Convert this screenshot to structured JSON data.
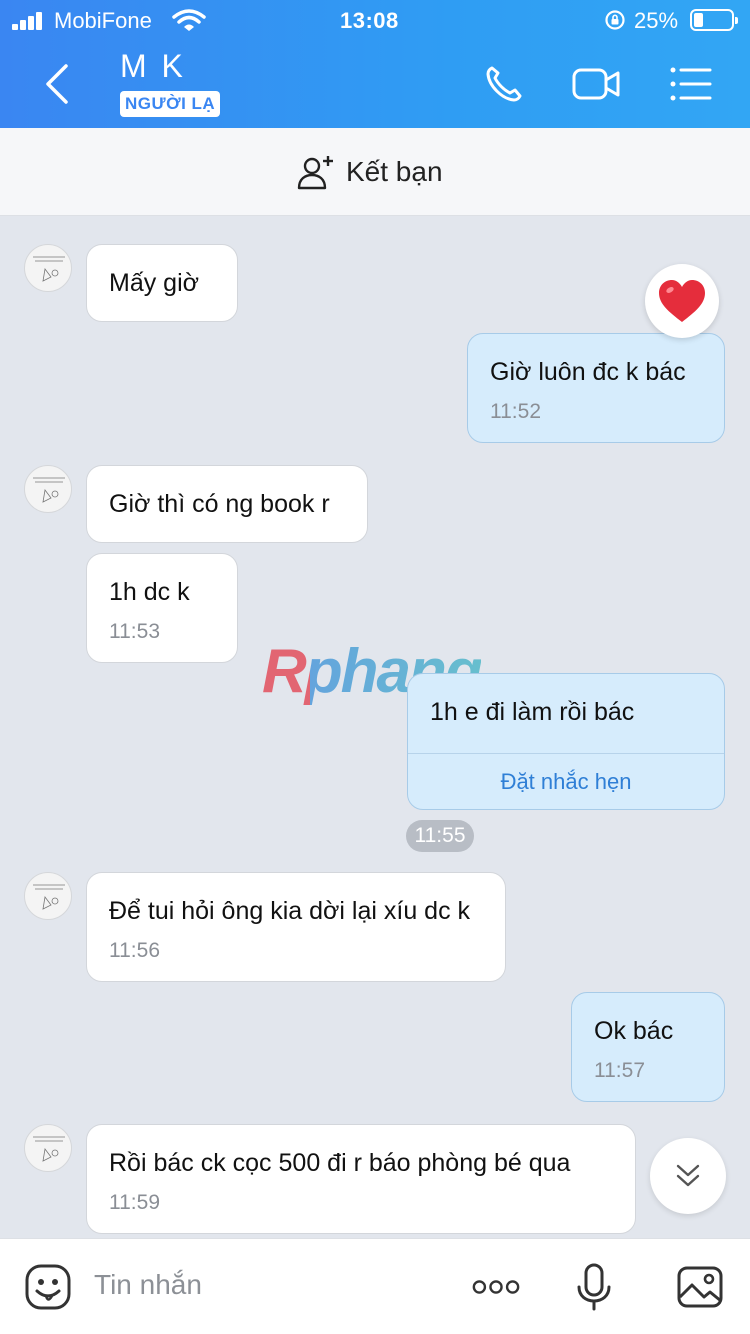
{
  "status_bar": {
    "carrier": "MobiFone",
    "time": "13:08",
    "battery": "25%"
  },
  "header": {
    "contact_name": "M K",
    "badge": "NGƯỜI LẠ"
  },
  "add_friend": {
    "label": "Kết bạn"
  },
  "messages": [
    {
      "side": "in",
      "text": "Mấy giờ",
      "time": ""
    },
    {
      "side": "out",
      "text": "Giờ luôn đc k bác",
      "time": "11:52",
      "reaction": "heart"
    },
    {
      "side": "in",
      "text": "Giờ thì có ng book r",
      "time": ""
    },
    {
      "side": "in",
      "text": "1h dc k",
      "time": "11:53"
    },
    {
      "side": "out",
      "text": "1h e đi làm rồi bác",
      "action": "Đặt nhắc hẹn"
    },
    {
      "side": "chip",
      "time": "11:55"
    },
    {
      "side": "in",
      "text": "Để tui hỏi ông kia dời lại xíu dc k",
      "time": "11:56"
    },
    {
      "side": "out",
      "text": "Ok bác",
      "time": "11:57"
    },
    {
      "side": "in",
      "text": "Rồi bác ck cọc 500 đi r báo phòng bé qua",
      "time": "11:59"
    }
  ],
  "watermark": "Rphang",
  "composer": {
    "placeholder": "Tin nhắn"
  }
}
